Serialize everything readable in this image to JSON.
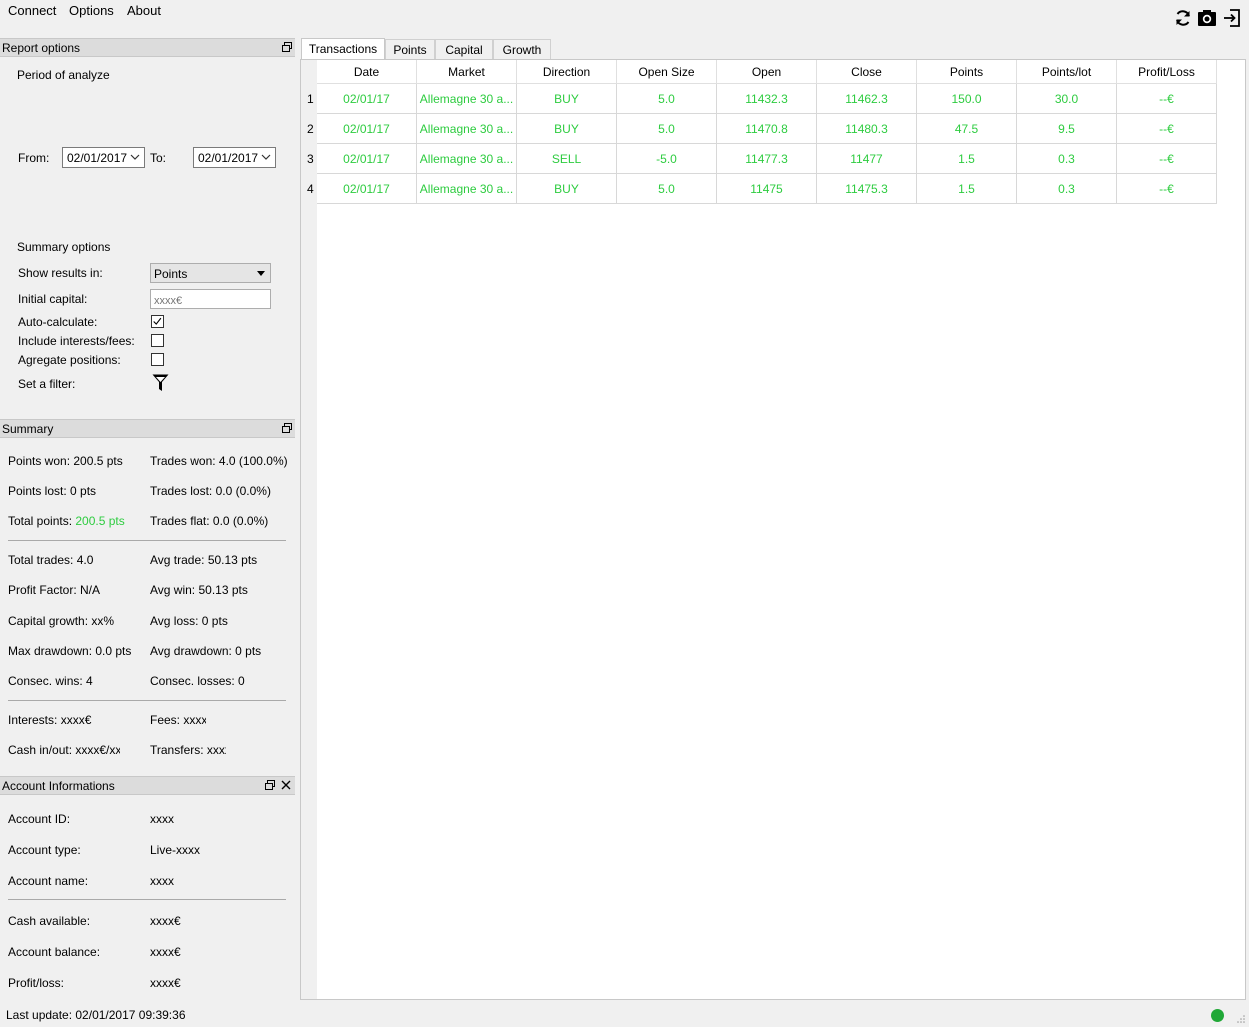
{
  "menu": {
    "connect": "Connect",
    "options": "Options",
    "about": "About"
  },
  "toolbar": {
    "refresh_icon": "refresh-icon",
    "camera_icon": "camera-icon",
    "export_icon": "export-icon"
  },
  "report_options": {
    "title": "Report options",
    "period_label": "Period of analyze",
    "from_label": "From:",
    "from_value": "02/01/2017",
    "to_label": "To:",
    "to_value": "02/01/2017",
    "summary_options_label": "Summary options",
    "show_results_label": "Show results in:",
    "show_results_value": "Points",
    "initial_capital_label": "Initial capital:",
    "initial_capital_placeholder": "xxxx€",
    "auto_calculate_label": "Auto-calculate:",
    "auto_calculate_checked": true,
    "include_interests_label": "Include interests/fees:",
    "include_interests_checked": false,
    "aggregate_label": "Agregate positions:",
    "aggregate_checked": false,
    "filter_label": "Set a filter:"
  },
  "summary": {
    "title": "Summary",
    "points_won": "Points won: 200.5 pts",
    "trades_won": "Trades won: 4.0 (100.0%)",
    "points_lost": "Points lost: 0 pts",
    "trades_lost": "Trades lost: 0.0 (0.0%)",
    "total_points_label": "Total points: ",
    "total_points_value": "200.5 pts",
    "trades_flat": "Trades flat: 0.0 (0.0%)",
    "total_trades": "Total trades: 4.0",
    "avg_trade": "Avg trade: 50.13 pts",
    "profit_factor": "Profit Factor: N/A",
    "avg_win": "Avg win: 50.13 pts",
    "capital_growth": "Capital growth: xx%",
    "avg_loss": "Avg loss: 0 pts",
    "max_drawdown": "Max drawdown: 0.0 pts",
    "avg_drawdown": "Avg drawdown: 0 pts",
    "consec_wins": "Consec. wins: 4",
    "consec_losses": "Consec. losses: 0",
    "interests": "Interests: xxxx€",
    "fees": "Fees: xxxx",
    "cash_inout": "Cash in/out: xxxx€/xx:",
    "transfers": "Transfers: xxxx"
  },
  "account": {
    "title": "Account Informations",
    "id_label": "Account ID:",
    "id_value": "xxxx",
    "type_label": "Account type:",
    "type_value": "Live-xxxx",
    "name_label": "Account name:",
    "name_value": "xxxx",
    "cash_label": "Cash available:",
    "cash_value": "xxxx€",
    "balance_label": "Account balance:",
    "balance_value": "xxxx€",
    "pl_label": "Profit/loss:",
    "pl_value": "xxxx€"
  },
  "status": {
    "last_update": "Last update: 02/01/2017 09:39:36",
    "connection_color": "#21a837"
  },
  "tabs": [
    "Transactions",
    "Points",
    "Capital",
    "Growth"
  ],
  "table": {
    "headers": [
      "Date",
      "Market",
      "Direction",
      "Open Size",
      "Open",
      "Close",
      "Points",
      "Points/lot",
      "Profit/Loss"
    ],
    "rows": [
      {
        "num": "1",
        "cells": [
          "02/01/17",
          "Allemagne 30 a...",
          "BUY",
          "5.0",
          "11432.3",
          "11462.3",
          "150.0",
          "30.0",
          "--€"
        ]
      },
      {
        "num": "2",
        "cells": [
          "02/01/17",
          "Allemagne 30 a...",
          "BUY",
          "5.0",
          "11470.8",
          "11480.3",
          "47.5",
          "9.5",
          "--€"
        ]
      },
      {
        "num": "3",
        "cells": [
          "02/01/17",
          "Allemagne 30 a...",
          "SELL",
          "-5.0",
          "11477.3",
          "11477",
          "1.5",
          "0.3",
          "--€"
        ]
      },
      {
        "num": "4",
        "cells": [
          "02/01/17",
          "Allemagne 30 a...",
          "BUY",
          "5.0",
          "11475",
          "11475.3",
          "1.5",
          "0.3",
          "--€"
        ]
      }
    ]
  },
  "colors": {
    "profit_green": "#2ecc40"
  }
}
